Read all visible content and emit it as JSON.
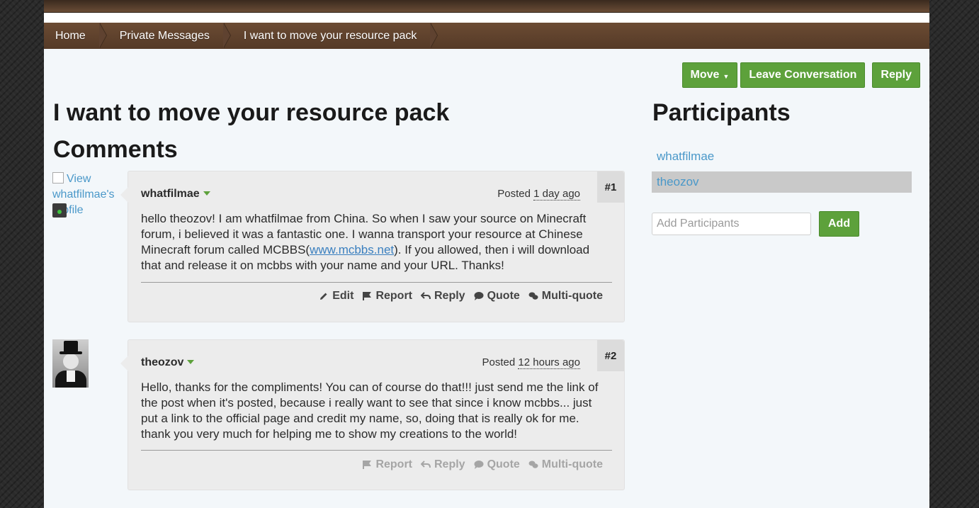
{
  "breadcrumb": [
    "Home",
    "Private Messages",
    "I want to move your resource pack"
  ],
  "actions": {
    "move": "Move",
    "leave": "Leave Conversation",
    "reply": "Reply"
  },
  "title": "I want to move your resource pack",
  "comments_heading": "Comments",
  "participants_heading": "Participants",
  "colors": {
    "accent": "#5da13b",
    "link": "#4a98c9",
    "header": "#5f4230"
  },
  "posts": [
    {
      "avatar_alt": "View whatfilmae's profile",
      "author": "whatfilmae",
      "posted_prefix": "Posted",
      "posted_ago": "1 day ago",
      "number": "#1",
      "text_before": "hello theozov! I am whatfilmae from China. So when I saw your source on Minecraft forum, i believed it was a fantastic one. I wanna transport your resource at Chinese Minecraft forum called MCBBS(",
      "link": "www.mcbbs.net",
      "text_after": "). If you allowed, then i will download that and release it on mcbbs with your name and your URL. Thanks!",
      "tools": [
        "Edit",
        "Report",
        "Reply",
        "Quote",
        "Multi-quote"
      ]
    },
    {
      "author": "theozov",
      "posted_prefix": "Posted",
      "posted_ago": "12 hours ago",
      "number": "#2",
      "text": "Hello, thanks for the compliments! You can of course do that!!! just send me the link of the post when it's posted, because i really want to see that since i know mcbbs... just put a link to the official page and credit my name, so, doing that is really ok for me. thank you very much for helping me to show my creations to the world!",
      "tools": [
        "Report",
        "Reply",
        "Quote",
        "Multi-quote"
      ]
    }
  ],
  "participants": [
    "whatfilmae",
    "theozov"
  ],
  "add": {
    "placeholder": "Add Participants",
    "button": "Add"
  },
  "icons": [
    "pencil-icon",
    "flag-icon",
    "reply-icon",
    "quote-bubble-icon",
    "multi-quote-icon",
    "chevron-down-icon"
  ]
}
